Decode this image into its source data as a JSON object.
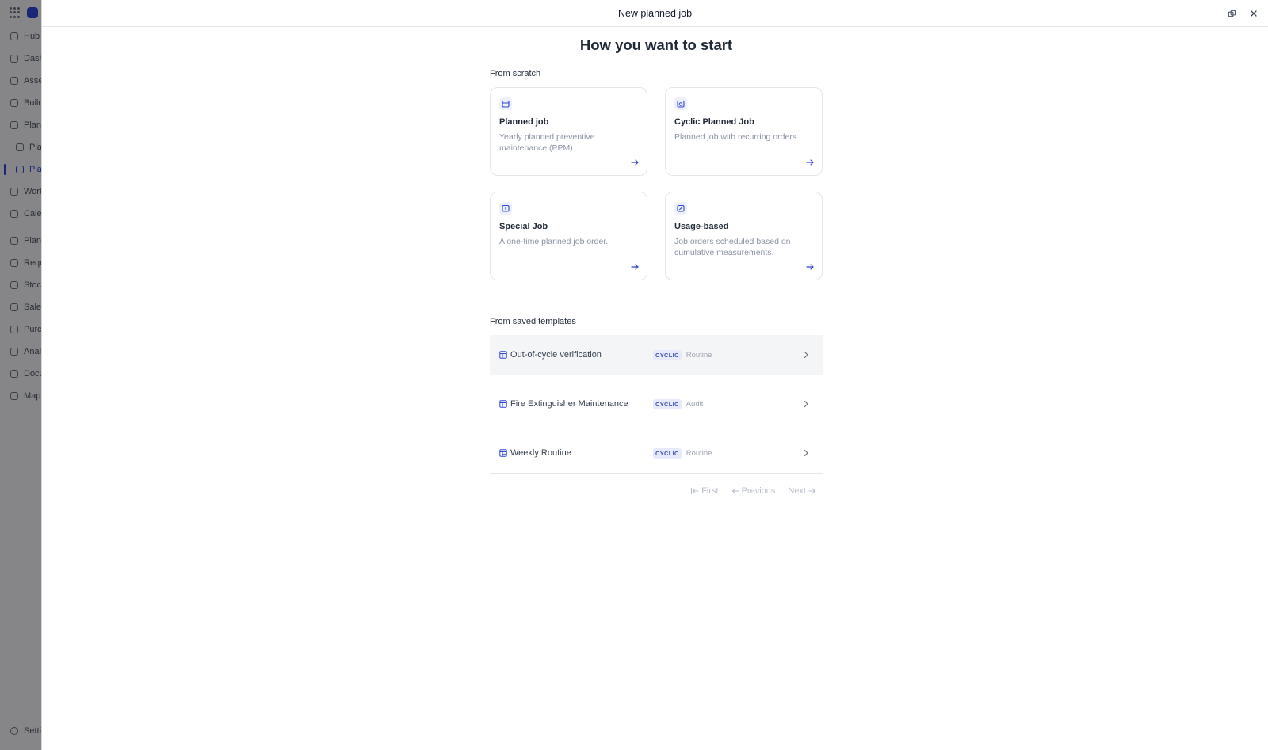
{
  "sidebar": {
    "items": [
      {
        "label": "Hub",
        "icon": "hub-icon"
      },
      {
        "label": "Dashboards",
        "icon": "dashboard-icon"
      },
      {
        "label": "Assets",
        "icon": "assets-icon"
      },
      {
        "label": "Buildings",
        "icon": "building-icon"
      },
      {
        "label": "Planning",
        "icon": "calendar-icon"
      },
      {
        "label": "Planned jobs",
        "icon": "planned-icon"
      },
      {
        "label": "Planned templates",
        "icon": "template-icon"
      },
      {
        "label": "Work orders",
        "icon": "workorder-icon"
      },
      {
        "label": "Calendar",
        "icon": "calendar-icon"
      },
      {
        "label": "Planned",
        "icon": "planned-icon"
      },
      {
        "label": "Requests",
        "icon": "request-icon"
      },
      {
        "label": "Stock",
        "icon": "stock-icon"
      },
      {
        "label": "Sales",
        "icon": "sales-icon"
      },
      {
        "label": "Purchases",
        "icon": "cart-icon"
      },
      {
        "label": "Analytics",
        "icon": "chart-icon"
      },
      {
        "label": "Documents",
        "icon": "document-icon"
      },
      {
        "label": "Map",
        "icon": "map-pin-icon"
      }
    ],
    "settings_label": "Settings"
  },
  "modal": {
    "title": "New planned job",
    "heading": "How you want to start",
    "from_scratch_label": "From scratch",
    "from_templates_label": "From saved templates",
    "cards": [
      {
        "title": "Planned job",
        "description": "Yearly planned preventive maintenance (PPM)."
      },
      {
        "title": "Cyclic Planned Job",
        "description": "Planned job with recurring orders."
      },
      {
        "title": "Special Job",
        "description": "A one-time planned job order."
      },
      {
        "title": "Usage-based",
        "description": "Job orders scheduled based on cumulative measurements."
      }
    ],
    "templates": [
      {
        "name": "Out-of-cycle verification",
        "badge": "CYCLIC",
        "type": "Routine"
      },
      {
        "name": "Fire Extinguisher Maintenance",
        "badge": "CYCLIC",
        "type": "Audit"
      },
      {
        "name": "Weekly Routine",
        "badge": "CYCLIC",
        "type": "Routine"
      }
    ],
    "pager": {
      "first": "First",
      "previous": "Previous",
      "next": "Next"
    }
  },
  "colors": {
    "accent": "#2f44d8",
    "badge_bg": "#e7eafc",
    "muted_text": "#8b93a3"
  }
}
